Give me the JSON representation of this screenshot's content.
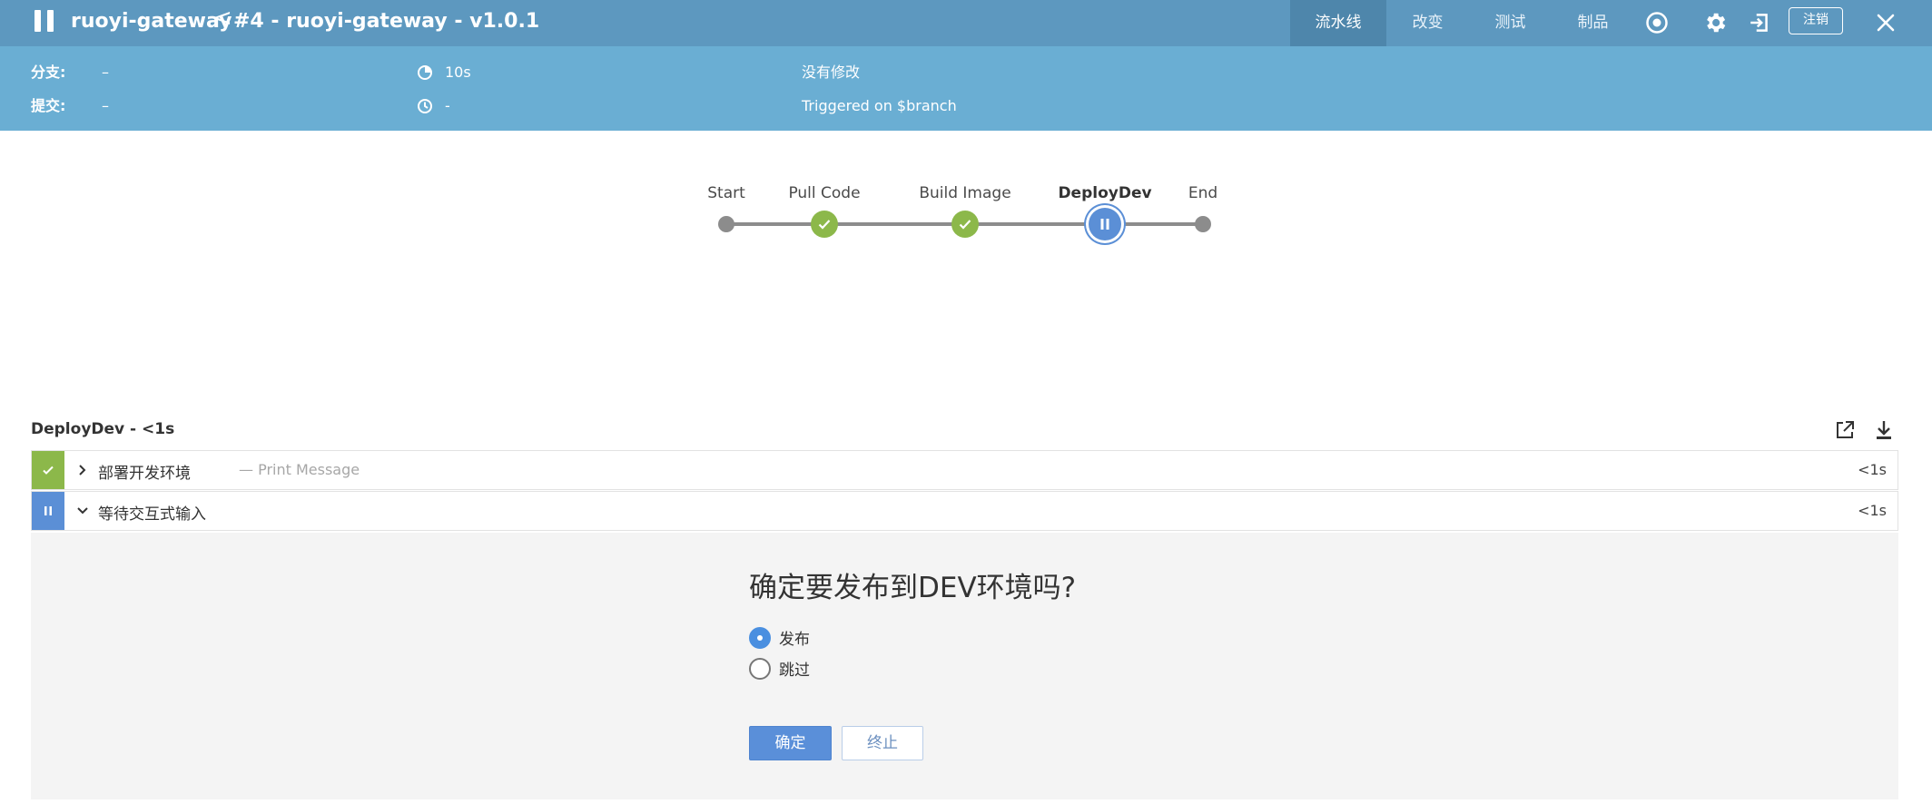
{
  "header": {
    "job_name": "ruoyi-gateway",
    "separator": "<",
    "run_title": "#4 - ruoyi-gateway - v1.0.1",
    "tabs": [
      {
        "label": "流水线",
        "active": true
      },
      {
        "label": "改变",
        "active": false
      },
      {
        "label": "测试",
        "active": false
      },
      {
        "label": "制品",
        "active": false
      }
    ],
    "logout_label": "注销",
    "bar_color": "#5d98bf",
    "active_tab_color": "#4e86ab"
  },
  "info": {
    "branch_label": "分支:",
    "branch_value": "–",
    "commit_label": "提交:",
    "commit_value": "–",
    "duration": "10s",
    "started": "-",
    "changes": "没有修改",
    "trigger": "Triggered on $branch",
    "bar_color": "#6aaed3"
  },
  "pipeline": {
    "stages": [
      {
        "label": "Start",
        "state": "start"
      },
      {
        "label": "Pull Code",
        "state": "success"
      },
      {
        "label": "Build Image",
        "state": "success"
      },
      {
        "label": "DeployDev",
        "state": "paused"
      },
      {
        "label": "End",
        "state": "end"
      }
    ],
    "success_color": "#8cb84a",
    "paused_color": "#5b8fd6"
  },
  "step_detail": {
    "title": "DeployDev - <1s",
    "steps": [
      {
        "name": "部署开发环境",
        "description": "— Print Message",
        "duration": "<1s",
        "state": "success",
        "expanded": false
      },
      {
        "name": "等待交互式输入",
        "description": "",
        "duration": "<1s",
        "state": "paused",
        "expanded": true
      }
    ]
  },
  "input_form": {
    "question": "确定要发布到DEV环境吗?",
    "options": [
      {
        "label": "发布",
        "selected": true
      },
      {
        "label": "跳过",
        "selected": false
      }
    ],
    "proceed_label": "确定",
    "abort_label": "终止",
    "primary_color": "#5a8fd9"
  }
}
